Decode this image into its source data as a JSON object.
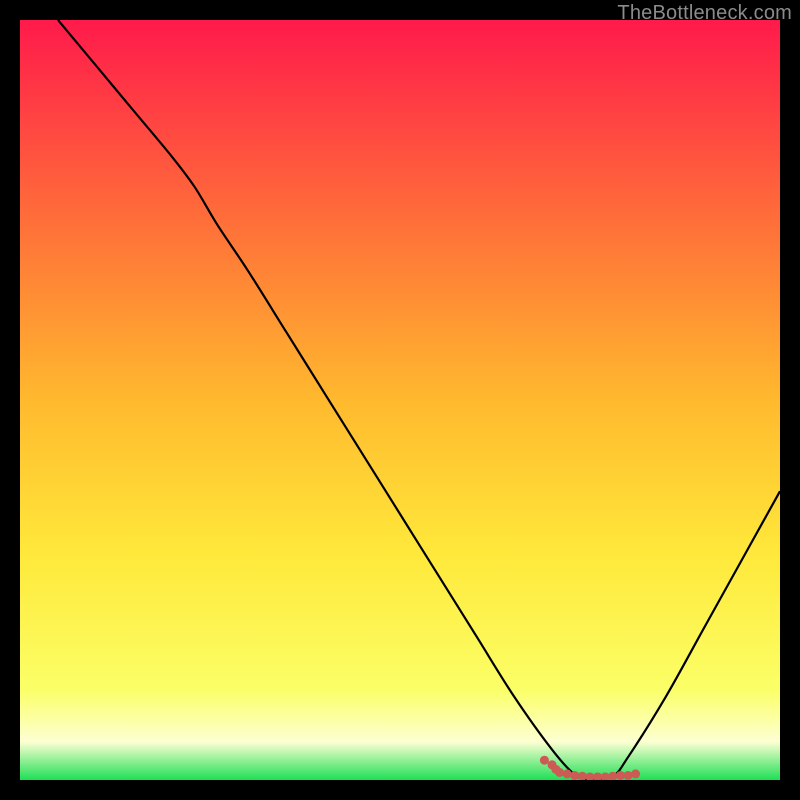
{
  "watermark": "TheBottleneck.com",
  "chart_data": {
    "type": "line",
    "title": "",
    "xlabel": "",
    "ylabel": "",
    "xlim": [
      0,
      100
    ],
    "ylim": [
      0,
      100
    ],
    "grid": false,
    "legend": false,
    "background_gradient": {
      "stops": [
        {
          "offset": 0.0,
          "color": "#ff1a4b"
        },
        {
          "offset": 0.25,
          "color": "#ff6a3a"
        },
        {
          "offset": 0.5,
          "color": "#ffb92e"
        },
        {
          "offset": 0.7,
          "color": "#ffe83a"
        },
        {
          "offset": 0.88,
          "color": "#fbff66"
        },
        {
          "offset": 0.95,
          "color": "#fcffd2"
        },
        {
          "offset": 1.0,
          "color": "#1fdf55"
        }
      ]
    },
    "series": [
      {
        "name": "curve",
        "color": "#000000",
        "width": 2.2,
        "x": [
          5,
          10,
          15,
          20,
          23,
          26,
          30,
          35,
          40,
          45,
          50,
          55,
          60,
          65,
          70,
          73,
          75,
          78,
          80,
          85,
          90,
          95,
          100
        ],
        "y": [
          100,
          94,
          88,
          82,
          78,
          73,
          67,
          59,
          51,
          43,
          35,
          27,
          19,
          11,
          4,
          0.7,
          0,
          0.5,
          3,
          11,
          20,
          29,
          38
        ]
      },
      {
        "name": "marker-cluster",
        "type": "scatter",
        "color": "#cc5a55",
        "size": 9,
        "x": [
          69,
          70,
          70.5,
          71,
          72,
          73,
          74,
          75,
          76,
          77,
          78,
          79,
          80,
          81
        ],
        "y": [
          2.6,
          2.0,
          1.4,
          1.0,
          0.8,
          0.6,
          0.5,
          0.4,
          0.4,
          0.4,
          0.5,
          0.6,
          0.6,
          0.8
        ]
      }
    ]
  }
}
